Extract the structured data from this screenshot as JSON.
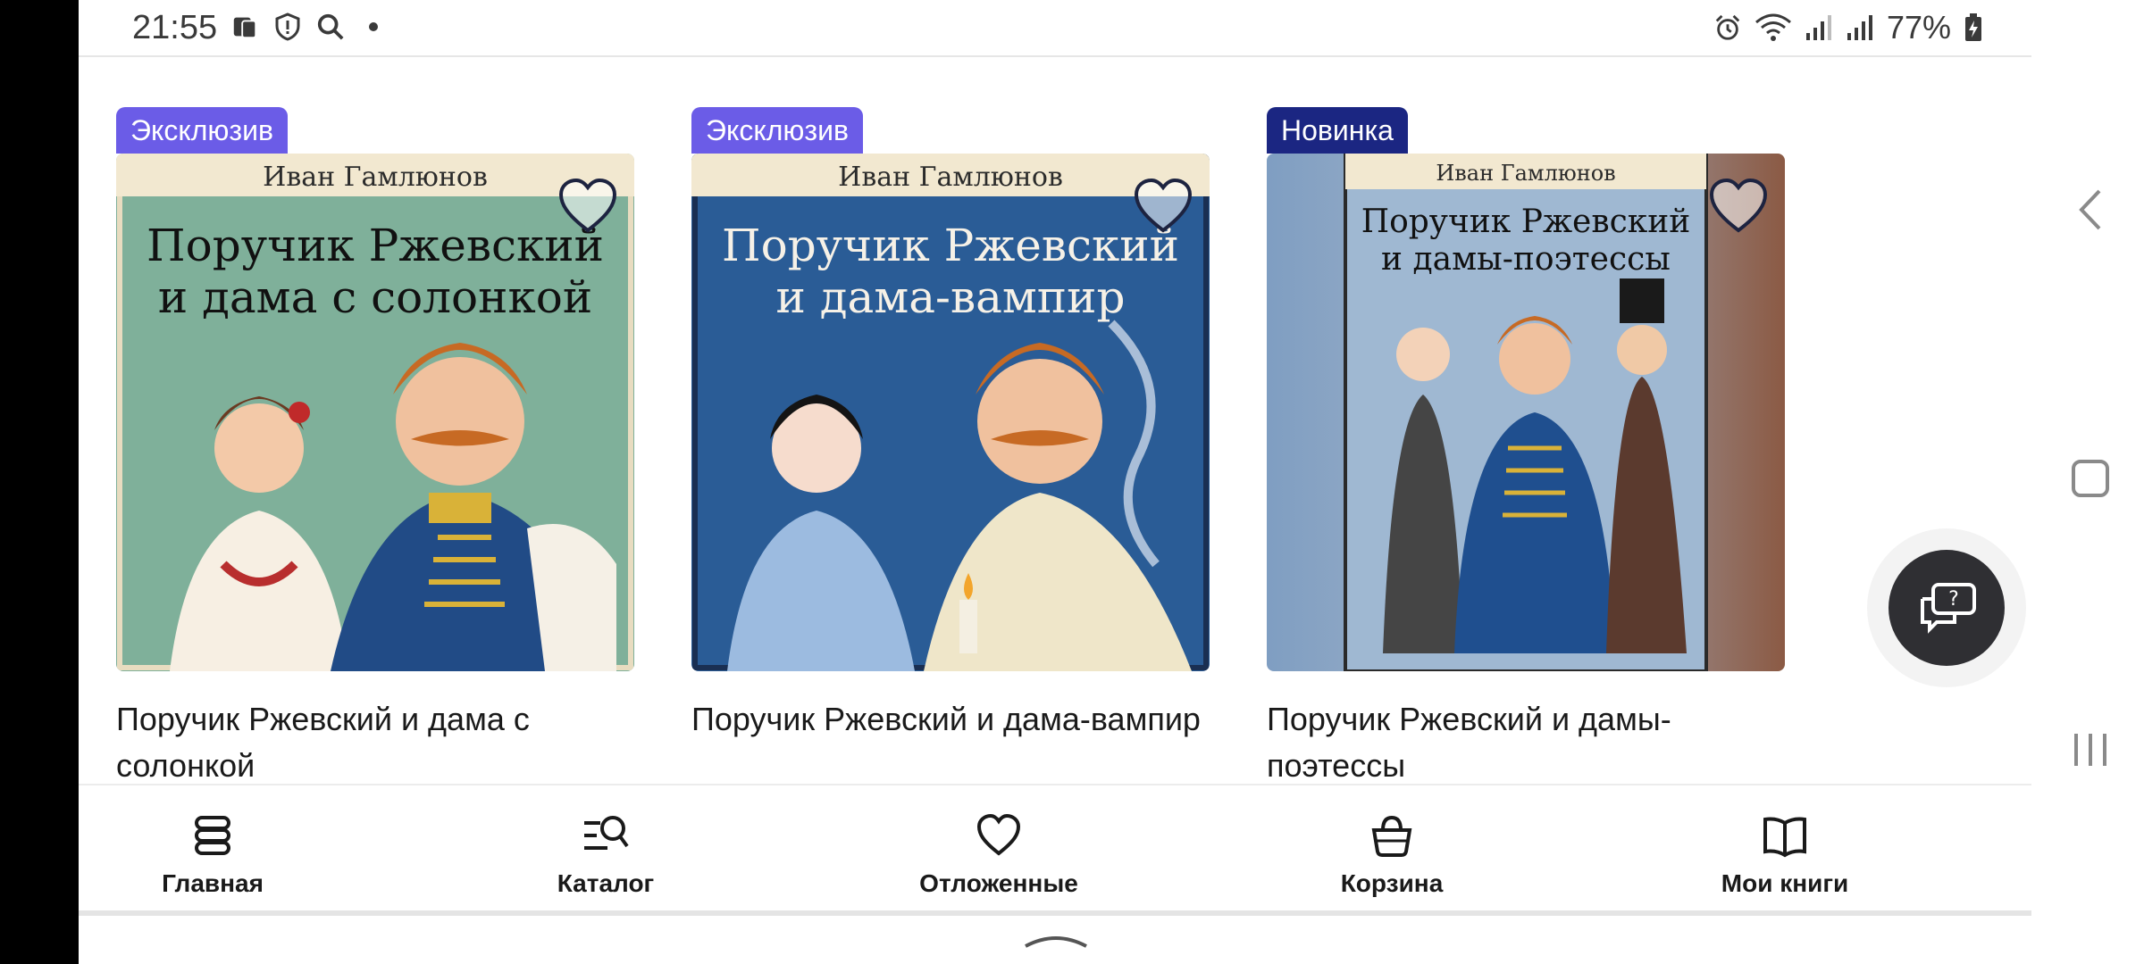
{
  "status_bar": {
    "time": "21:55",
    "battery": "77%",
    "left_icons": [
      "notification-icon",
      "shield-icon",
      "search-icon",
      "dot-icon"
    ],
    "right_icons": [
      "alarm-icon",
      "wifi-icon",
      "signal-icon",
      "signal-icon",
      "battery-charging-icon"
    ]
  },
  "books": [
    {
      "badge": "Эксклюзив",
      "badge_type": "exclusive",
      "title": "Поручик Ржевский и дама с солонкой",
      "cover_author": "Иван Гамлюнов",
      "cover_line1": "Поручик Ржевский",
      "cover_line2": "и дама с солонкой",
      "cover_bg": "#7fb09a"
    },
    {
      "badge": "Эксклюзив",
      "badge_type": "exclusive",
      "title": "Поручик Ржевский и дама-вампир",
      "cover_author": "Иван Гамлюнов",
      "cover_line1": "Поручик Ржевский",
      "cover_line2": "и дама-вампир",
      "cover_bg": "#2a5c96"
    },
    {
      "badge": "Новинка",
      "badge_type": "new",
      "title": "Поручик Ржевский и дамы-поэтессы",
      "cover_author": "Иван Гамлюнов",
      "cover_line1": "Поручик Ржевский",
      "cover_line2": "и дамы-поэтессы",
      "cover_bg": "#8fa9c4"
    }
  ],
  "nav": [
    {
      "label": "Главная",
      "icon": "home-icon"
    },
    {
      "label": "Каталог",
      "icon": "catalog-search-icon"
    },
    {
      "label": "Отложенные",
      "icon": "heart-icon"
    },
    {
      "label": "Корзина",
      "icon": "basket-icon"
    },
    {
      "label": "Мои книги",
      "icon": "open-book-icon"
    }
  ],
  "colors": {
    "exclusive_badge": "#6b5ce7",
    "new_badge": "#1b2682",
    "fab": "#2f2f33"
  }
}
